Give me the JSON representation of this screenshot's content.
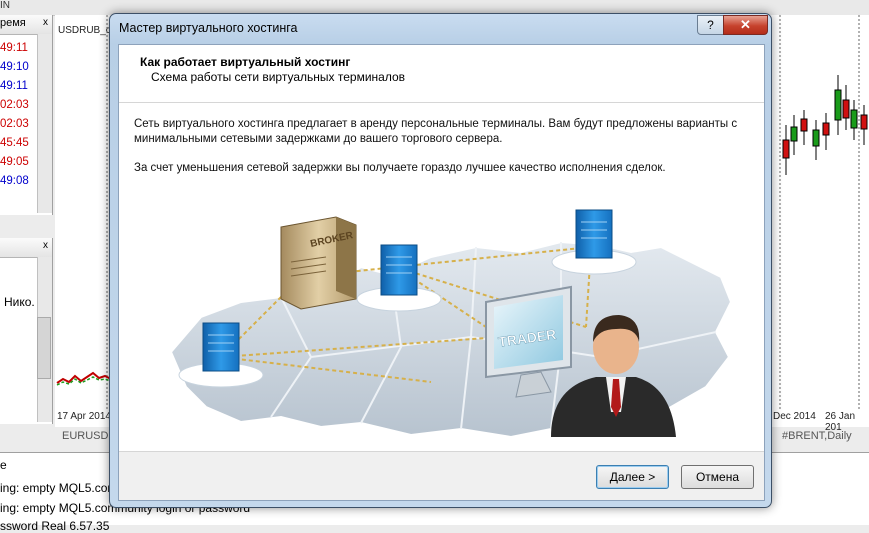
{
  "background": {
    "top_fragment": "IN",
    "watch": {
      "header": "ремя",
      "close": "x",
      "times": [
        {
          "t": "49:11",
          "c": "#cc0000"
        },
        {
          "t": "49:10",
          "c": "#0000cc"
        },
        {
          "t": "49:11",
          "c": "#0000cc"
        },
        {
          "t": "02:03",
          "c": "#cc0000"
        },
        {
          "t": "02:03",
          "c": "#cc0000"
        },
        {
          "t": "45:45",
          "c": "#cc0000"
        },
        {
          "t": "49:05",
          "c": "#cc0000"
        },
        {
          "t": "49:08",
          "c": "#0000cc"
        }
      ]
    },
    "navigator": {
      "close": "x",
      "text": "Нико."
    },
    "chart_left": {
      "symbol": "USDRUB_c",
      "date": "17 Apr 2014",
      "tab": "EURUSD,"
    },
    "chart_right": {
      "date1": "Dec 2014",
      "date2": "26 Jan 201",
      "tab": "#BRENT,Daily"
    },
    "log": {
      "line0": "e",
      "line1": "ing: empty MQL5.com",
      "line2": "ing: empty MQL5.community login or password",
      "line3": "ssword Real 6.57.35"
    }
  },
  "dialog": {
    "title": "Мастер виртуального хостинга",
    "help_label": "?",
    "close_label": "✕",
    "header_title": "Как работает виртуальный хостинг",
    "header_subtitle": "Схема работы сети виртуальных терминалов",
    "paragraph1": "Сеть виртуального хостинга предлагает в аренду персональные терминалы. Вам будут предложены варианты с минимальными сетевыми задержками до вашего торгового сервера.",
    "paragraph2": "За счет уменьшения сетевой задержки вы получаете гораздо лучшее качество исполнения сделок.",
    "illustration": {
      "broker_label": "BROKER",
      "trader_label": "TRADER"
    },
    "next_label": "Далее >",
    "cancel_label": "Отмена"
  },
  "colors": {
    "title_bar": "#b8cfe6",
    "close": "#c6422d",
    "server_blue": "#1a7fd1",
    "map": "#c9d4df"
  }
}
